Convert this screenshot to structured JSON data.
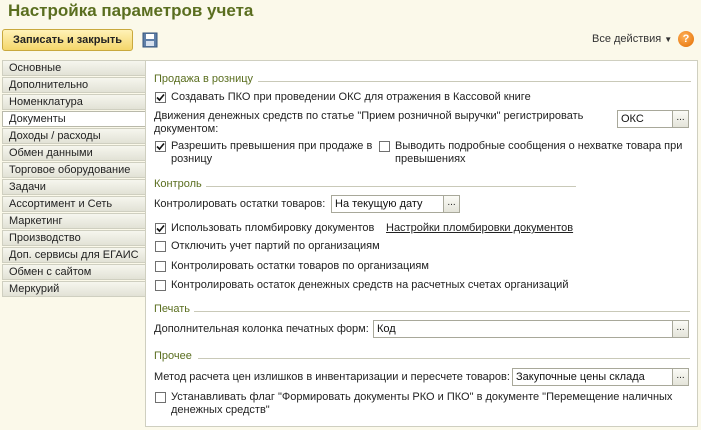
{
  "window": {
    "title": "Настройка параметров учета"
  },
  "toolbar": {
    "save_close_label": "Записать и закрыть",
    "all_actions_label": "Все действия",
    "help_label": "?"
  },
  "sidebar": {
    "active_index": 3,
    "items": [
      "Основные",
      "Дополнительно",
      "Номенклатура",
      "Документы",
      "Доходы / расходы",
      "Обмен данными",
      "Торговое оборудование",
      "Задачи",
      "Ассортимент и Сеть",
      "Маркетинг",
      "Производство",
      "Доп. сервисы для ЕГАИС",
      "Обмен с сайтом",
      "Меркурий"
    ]
  },
  "retail": {
    "title": "Продажа в розницу",
    "create_pko_label": "Создавать ПКО при проведении ОКС для отражения в Кассовой книге",
    "create_pko_checked": true,
    "movement_label_line1": "Движения денежных средств по статье \"Прием розничной выручки\" регистрировать",
    "movement_label_line2": "документом:",
    "movement_value": "ОКС",
    "allow_excess_line1": "Разрешить превышения при продаже в",
    "allow_excess_line2": "розницу",
    "allow_excess_checked": true,
    "detailed_msgs_line1": "Выводить подробные сообщения о нехватке товара при",
    "detailed_msgs_line2": "превышениях",
    "detailed_msgs_checked": false
  },
  "control": {
    "title": "Контроль",
    "stock_label": "Контролировать остатки товаров:",
    "stock_value": "На текущую дату",
    "sealing_label": "Использовать пломбировку документов",
    "sealing_checked": true,
    "sealing_link": "Настройки пломбировки документов",
    "batch_label": "Отключить учет партий по организациям",
    "batch_checked": false,
    "stock_by_org_label": "Контролировать остатки товаров по организациям",
    "stock_by_org_checked": false,
    "cash_balance_label": "Контролировать остаток денежных средств на расчетных счетах организаций",
    "cash_balance_checked": false
  },
  "print": {
    "title": "Печать",
    "extra_column_label": "Дополнительная колонка печатных форм:",
    "extra_column_value": "Код"
  },
  "other": {
    "title": "Прочее",
    "pricing_label": "Метод расчета цен излишков в инвентаризации и пересчете товаров:",
    "pricing_value": "Закупочные цены склада",
    "flag_line1": "Устанавливать флаг \"Формировать документы РКО и ПКО\" в документе \"Перемещение наличных",
    "flag_line2": "денежных средств\"",
    "flag_checked": false
  },
  "colors": {
    "title_green": "#5a6e1f",
    "link_blue": "#1a4ea3",
    "save_button_yellow": "#f4d66a",
    "background": "#fbf9ea"
  }
}
